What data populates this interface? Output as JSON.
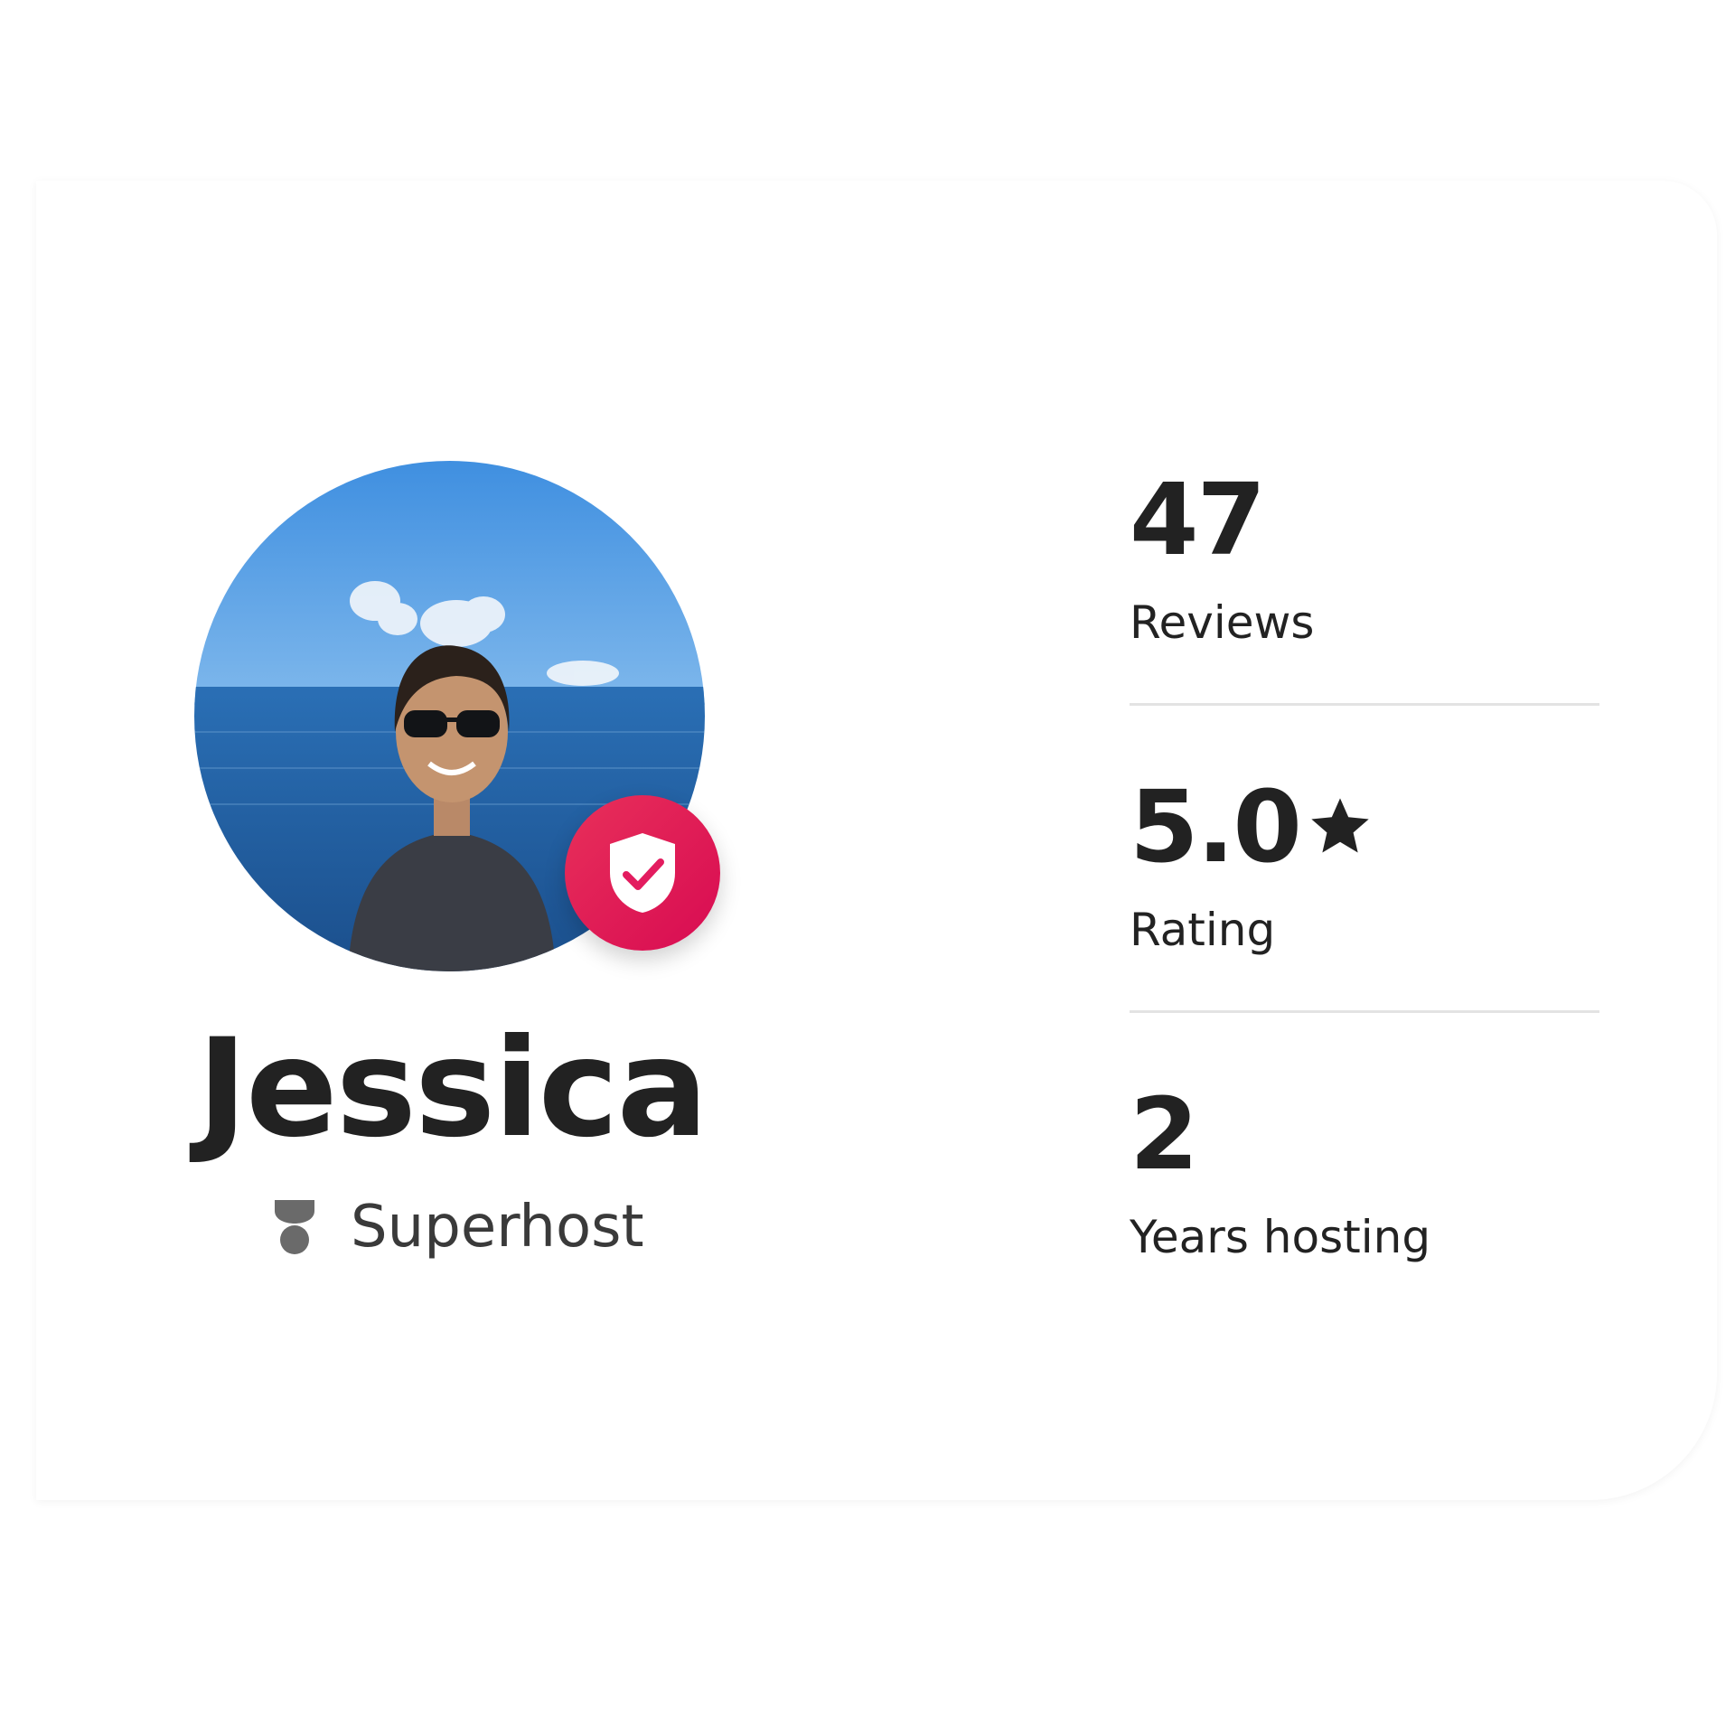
{
  "host": {
    "name": "Jessica",
    "badge_label": "Superhost",
    "badge_icon": "superhost-icon",
    "verified_icon": "verified-shield-icon"
  },
  "stats": [
    {
      "value": "47",
      "label": "Reviews"
    },
    {
      "value": "5.0",
      "label": "Rating",
      "icon": "star-icon"
    },
    {
      "value": "2",
      "label": "Years hosting"
    }
  ],
  "colors": {
    "accent": "#E31C5F",
    "text": "#222222",
    "divider": "#E3E3E3"
  }
}
